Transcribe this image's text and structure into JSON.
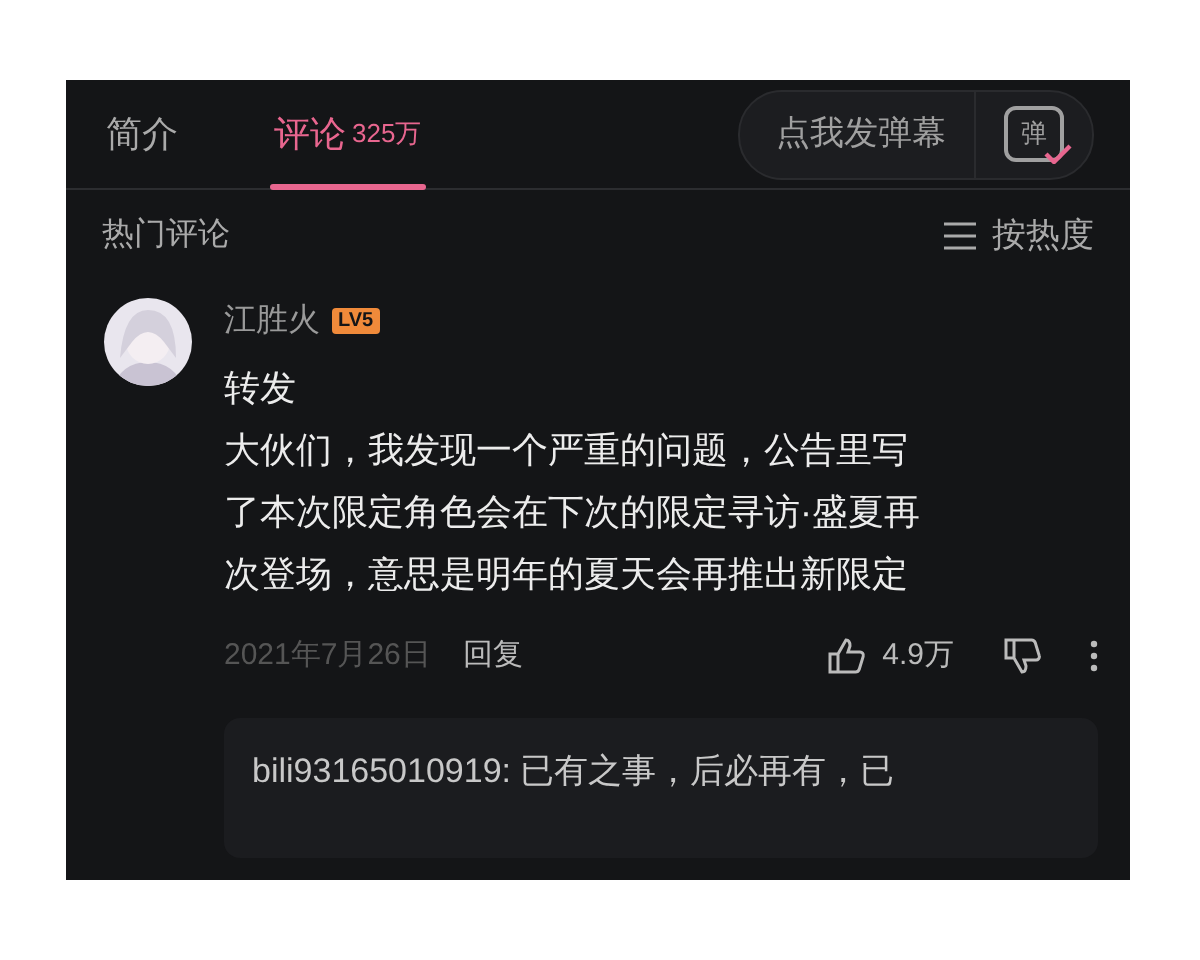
{
  "tabs": [
    {
      "label": "简介",
      "selected": false
    },
    {
      "label": "评论",
      "count": "325万",
      "selected": true
    }
  ],
  "danmaku": {
    "label": "点我发弹幕",
    "icon_text": "弹"
  },
  "section": {
    "title": "热门评论",
    "sort": "按热度"
  },
  "comment": {
    "user": "江胜火",
    "level": "LV5",
    "body": [
      "转发",
      "大伙们，我发现一个严重的问题，公告里写",
      "了本次限定角色会在下次的限定寻访·盛夏再",
      "次登场，意思是明年的夏天会再推出新限定"
    ],
    "date": "2021年7月26日",
    "reply_label": "回复",
    "likes": "4.9万",
    "reply": "bili93165010919: 已有之事，后必再有，已"
  }
}
